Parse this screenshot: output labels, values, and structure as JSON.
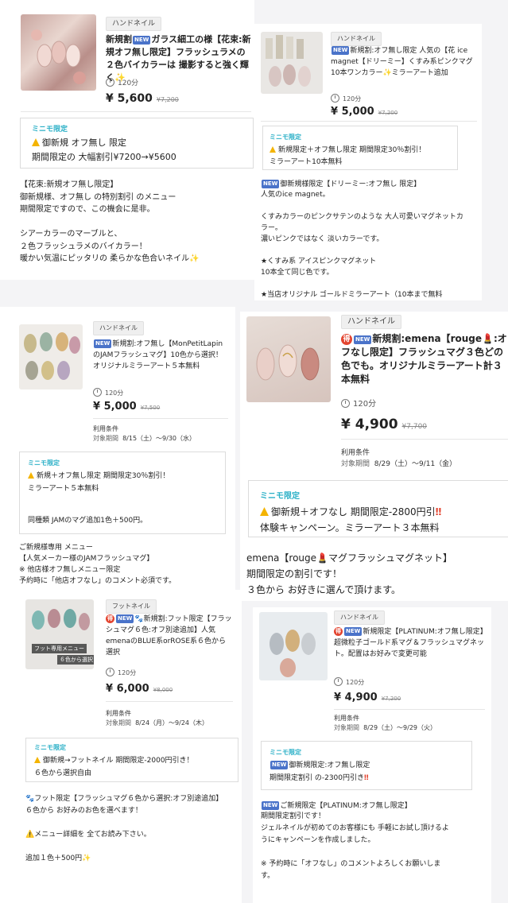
{
  "cards": [
    {
      "tag": "ハンドネイル",
      "title_pre": "新規割",
      "title_rest": "ガラス細工の様【花束:新規オフ無し限定】フラッシュラメの２色バイカラーは 撮影すると強く輝く✨",
      "time": "120分",
      "price": "¥ 5,600",
      "old_price": "¥7,200",
      "mini_label": "ミニモ限定",
      "mini_l1": "御新規 オフ無し 限定",
      "mini_l2": "期間限定の 大幅割引¥7200→¥5600",
      "desc": "【花束:新規オフ無し限定】\n御新規様、オフ無し の特別割引 のメニュー\n期間限定ですので、この機会に是非。\n\nシアーカラーのマーブルと、\n２色フラッシュラメのバイカラー！\n暖かい気温にピッタリの 柔らかな色合いネイル✨"
    },
    {
      "tag": "ハンドネイル",
      "title_pre": "新規割:オフ無し限定",
      "title_rest": "人気の【花 ice magnet【ドリーミー】くすみ系ピンクマグ10本ワンカラー✨ミラーアート追加",
      "time": "120分",
      "price": "¥ 5,000",
      "old_price": "¥7,200",
      "mini_label": "ミニモ限定",
      "mini_l1": "新規限定＋オフ無し限定 期間限定30％割引！",
      "mini_l2": "ミラーアート10本無料",
      "desc_title": "御新規様限定【ドリーミー:オフ無し 限定】",
      "desc": "人気のice magnet。\n\nくすみカラーのピンクサテンのような 大人可愛いマグネットカラー。\n濃いピンクではなく 淡いカラーです。\n\n★くすみ系 アイスピンクマグネット\n10本全て同じ色です。\n\n★当店オリジナル ゴールドミラーアート（10本まで無料"
    },
    {
      "tag": "ハンドネイル",
      "title_pre": "新規割:オフ無し",
      "title_rest": "【MonPetitLapinのJAMフラッシュマグ】10色から選択！オリジナルミラーアート５本無料",
      "time": "120分",
      "price": "¥ 5,000",
      "old_price": "¥7,500",
      "cond_title": "利用条件",
      "cond_label": "対象期間",
      "cond_range": "8/15（土）〜9/30（水）",
      "mini_label": "ミニモ限定",
      "mini_l1": "新規＋オフ無し限定 期間限定30％割引！",
      "mini_l2": "ミラーアート５本無料",
      "mini_l3": "同種類 JAMのマグ追加1色＋500円。",
      "desc": "ご新規様専用 メニュー\n【人気メーカー様のJAMフラッシュマグ】\n※ 他店様オフ無しメニュー限定\n予約時に「他店オフなし」のコメント必須です。"
    },
    {
      "tag": "ハンドネイル",
      "title_pre": "新規割:emena【rouge",
      "title_rest": ":オフなし限定】フラッシュマグ３色どの色でも。オリジナルミラーアート計３本無料",
      "time": "120分",
      "price": "¥ 4,900",
      "old_price": "¥7,700",
      "cond_title": "利用条件",
      "cond_label": "対象期間",
      "cond_range": "8/29（土）〜9/11（金）",
      "mini_label": "ミニモ限定",
      "mini_l1": "御新規＋オフなし 期間限定-2800円引",
      "mini_l2": "体験キャンペーン。ミラーアート３本無料",
      "desc": "emena【rouge💄マグフラッシュマグネット】\n期間限定の割引です！\n３色から お好きに選んで頂けます。"
    },
    {
      "tag": "フットネイル",
      "thumb_caption_1": "フット専用メニュー",
      "thumb_caption_2": "６色から選択",
      "title_pre": "新規割:フット限定",
      "title_rest": "【フラッシュマグ６色:オフ別途追加】人気emenaのBLUE系orROSE系６色から選択",
      "time": "120分",
      "price": "¥ 6,000",
      "old_price": "¥8,000",
      "cond_title": "利用条件",
      "cond_label": "対象期間",
      "cond_range": "8/24（月）〜9/24（木）",
      "mini_label": "ミニモ限定",
      "mini_l1": "御新規→フットネイル 期間限定-2000円引き！",
      "mini_l2": "６色から選択自由",
      "desc": "🐾フット限定【フラッシュマグ６色から選択:オフ別途追加】\n６色から お好みのお色を選べます！\n\n⚠️メニュー詳細を 全てお読み下さい。\n\n追加１色＋500円✨"
    },
    {
      "tag": "ハンドネイル",
      "title_pre": "新規限定",
      "title_rest": "【PLATINUM:オフ無し限定】超微粒子ゴールド系マグ＆フラッシュマグネット。配置はお好みで変更可能",
      "time": "120分",
      "price": "¥ 4,900",
      "old_price": "¥7,200",
      "cond_title": "利用条件",
      "cond_label": "対象期間",
      "cond_range": "8/29（土）〜9/29（火）",
      "mini_label": "ミニモ限定",
      "mini_l1": "御新規限定:オフ無し限定",
      "mini_l2": "期間限定割引 の-2300円引き",
      "desc_title": "ご新規限定【PLATINUM:オフ無し限定】",
      "desc": "期間限定割引です！\nジェルネイルが初めてのお客様にも 手軽にお試し頂けるようにキャンペーンを作成しました。\n\n※ 予約時に「オフなし」のコメントよろしくお願いします。"
    }
  ],
  "new_badge": "NEW",
  "toku_badge": "得",
  "colors": {
    "accent": "#2bb0c7",
    "new": "#4a73c9",
    "toku": "#e3442f"
  }
}
